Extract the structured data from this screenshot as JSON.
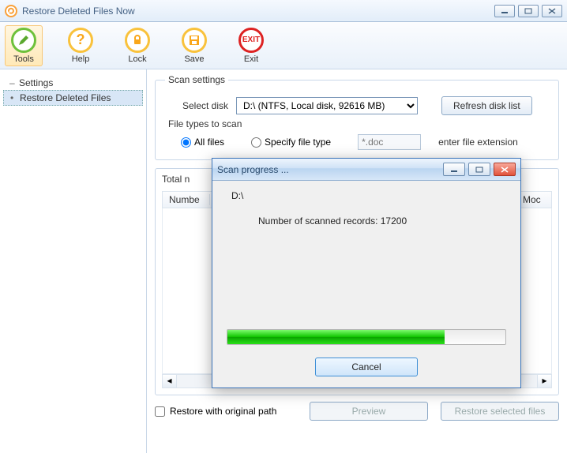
{
  "window": {
    "title": "Restore Deleted Files Now"
  },
  "toolbar": {
    "tools": {
      "label": "Tools"
    },
    "help": {
      "label": "Help"
    },
    "lock": {
      "label": "Lock"
    },
    "save": {
      "label": "Save"
    },
    "exit": {
      "label": "Exit",
      "icon_text": "EXIT"
    }
  },
  "sidebar": {
    "items": [
      {
        "label": "Settings"
      },
      {
        "label": "Restore Deleted Files"
      }
    ]
  },
  "scan_settings": {
    "legend": "Scan settings",
    "select_disk_label": "Select disk",
    "disk_value": "D:\\  (NTFS, Local disk, 92616 MB)",
    "refresh_label": "Refresh disk list",
    "file_types_legend": "File types to scan",
    "all_files_label": "All files",
    "specify_label": "Specify file type",
    "ext_placeholder": "*.doc",
    "ext_hint": "enter file extension"
  },
  "results": {
    "total_prefix": "Total n",
    "col_number": "Numbe",
    "col_modified": "Moc"
  },
  "footer": {
    "restore_path_label": "Restore with original path",
    "preview_label": "Preview",
    "restore_selected_label": "Restore selected files"
  },
  "dialog": {
    "title": "Scan progress ...",
    "path": "D:\\",
    "records_label": "Number of scanned records:",
    "records_value": "17200",
    "progress_pct": 78,
    "cancel_label": "Cancel"
  }
}
